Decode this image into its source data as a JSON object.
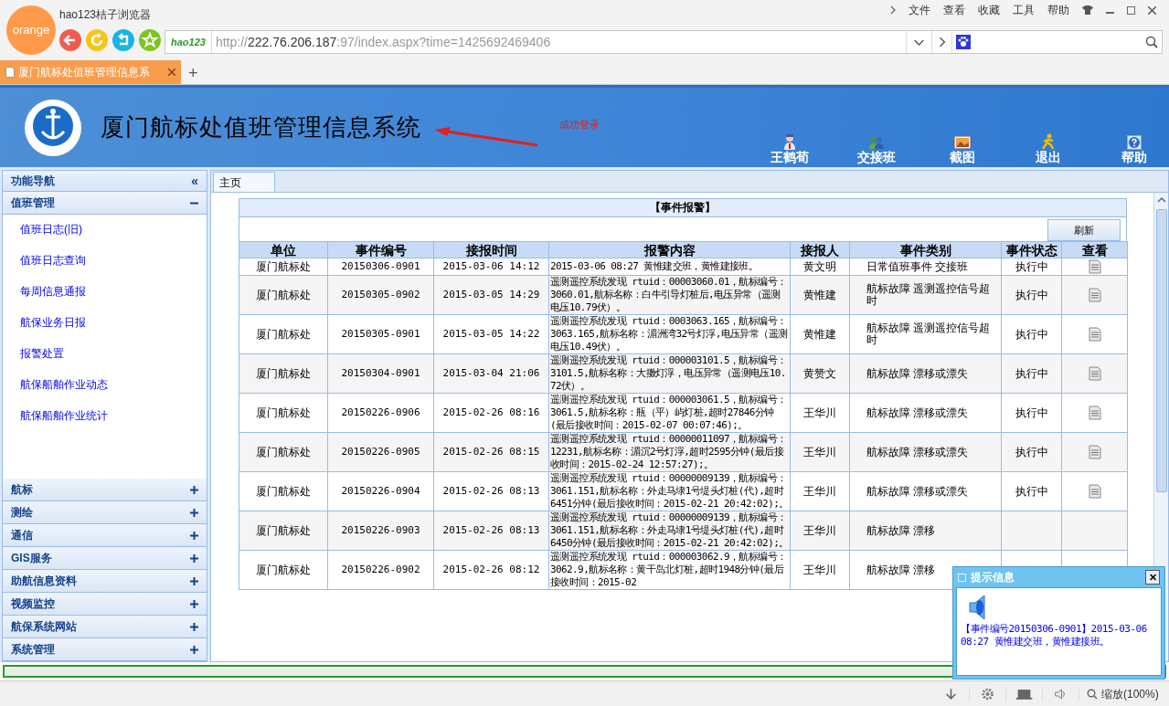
{
  "browser": {
    "logo": "orange",
    "title": "hao123桔子浏览器",
    "menu": [
      "文件",
      "查看",
      "收藏",
      "工具",
      "帮助"
    ],
    "url_badge": "hao123",
    "url": {
      "scheme": "http://",
      "host": "222.76.206.187",
      "rest": ":97/index.aspx?time=1425692469406"
    },
    "tabs": [
      {
        "label": "厦门航标处值班管理信息系",
        "selected": true
      }
    ],
    "new_tab": "+"
  },
  "header": {
    "title": "厦门航标处值班管理信息系统",
    "note": "成功登录",
    "tools": [
      {
        "kind": "user",
        "label": "王鹤荀"
      },
      {
        "kind": "handover",
        "label": "交接班"
      },
      {
        "kind": "screenshot",
        "label": "截图"
      },
      {
        "kind": "logout",
        "label": "退出"
      },
      {
        "kind": "help",
        "label": "帮助"
      }
    ]
  },
  "sidebar": {
    "title": "功能导航",
    "collapse": "«",
    "groups": [
      {
        "label": "值班管理",
        "expanded": true,
        "children": [
          {
            "label": "值班日志(旧)"
          },
          {
            "label": "值班日志查询"
          },
          {
            "label": "每周信息通报"
          },
          {
            "label": "航保业务日报"
          },
          {
            "label": "报警处置"
          },
          {
            "label": "航保船舶作业动态"
          },
          {
            "label": "航保船舶作业统计"
          }
        ]
      },
      {
        "label": "航标",
        "expanded": false
      },
      {
        "label": "测绘",
        "expanded": false
      },
      {
        "label": "通信",
        "expanded": false
      },
      {
        "label": "GIS服务",
        "expanded": false
      },
      {
        "label": "助航信息资料",
        "expanded": false
      },
      {
        "label": "视频监控",
        "expanded": false
      },
      {
        "label": "航保系统网站",
        "expanded": false
      },
      {
        "label": "系统管理",
        "expanded": false
      }
    ]
  },
  "content_tabs": [
    {
      "label": "主页",
      "selected": true
    }
  ],
  "table": {
    "title": "【事件报警】",
    "refresh": "刷新",
    "columns": [
      "单位",
      "事件编号",
      "接报时间",
      "报警内容",
      "接报人",
      "事件类别",
      "事件状态",
      "查看"
    ],
    "rows": [
      {
        "unit": "厦门航标处",
        "id": "20150306-0901",
        "time": "2015-03-06 14:12",
        "content": "2015-03-06 08:27 黄惟建交班，黄惟建接班。",
        "person": "黄文明",
        "category": "日常值班事件 交接班",
        "status": "执行中"
      },
      {
        "unit": "厦门航标处",
        "id": "20150305-0902",
        "time": "2015-03-05 14:29",
        "content": "遥测遥控系统发现 rtuid：00003060.01，航标编号：3060.01,航标名称：白牛引导灯桩后,电压异常（遥测电压10.79伏）。",
        "person": "黄惟建",
        "category": "航标故障 遥测遥控信号超时",
        "status": "执行中"
      },
      {
        "unit": "厦门航标处",
        "id": "20150305-0901",
        "time": "2015-03-05 14:22",
        "content": "遥测遥控系统发现 rtuid：0003063.165，航标编号：3063.165,航标名称：湄洲湾32号灯浮,电压异常（遥测电压10.49伏）。",
        "person": "黄惟建",
        "category": "航标故障 遥测遥控信号超时",
        "status": "执行中"
      },
      {
        "unit": "厦门航标处",
        "id": "20150304-0901",
        "time": "2015-03-04 21:06",
        "content": "遥测遥控系统发现 rtuid：000003101.5，航标编号：3101.5,航标名称：大擞灯浮，电压异常（遥测电压10.72伏）。",
        "person": "黄赞文",
        "category": "航标故障 漂移或漂失",
        "status": "执行中"
      },
      {
        "unit": "厦门航标处",
        "id": "20150226-0906",
        "time": "2015-02-26 08:16",
        "content": "遥测遥控系统发现 rtuid：000003061.5，航标编号：3061.5,航标名称：瓶（平）屿灯桩,超时27846分钟(最后接收时间：2015-02-07 00:07:46);。",
        "person": "王华川",
        "category": "航标故障 漂移或漂失",
        "status": "执行中"
      },
      {
        "unit": "厦门航标处",
        "id": "20150226-0905",
        "time": "2015-02-26 08:15",
        "content": "遥测遥控系统发现 rtuid：00000011097，航标编号：12231,航标名称：湄沉2号灯浮,超时2595分钟(最后接收时间：2015-02-24 12:57:27);。",
        "person": "王华川",
        "category": "航标故障 漂移或漂失",
        "status": "执行中"
      },
      {
        "unit": "厦门航标处",
        "id": "20150226-0904",
        "time": "2015-02-26 08:13",
        "content": "遥测遥控系统发现 rtuid：00000009139，航标编号：3061.151,航标名称：外走马埭1号堤头灯桩(代),超时6451分钟(最后接收时间：2015-02-21 20:42:02);。",
        "person": "王华川",
        "category": "航标故障 漂移或漂失",
        "status": "执行中"
      },
      {
        "unit": "厦门航标处",
        "id": "20150226-0903",
        "time": "2015-02-26 08:13",
        "content": "遥测遥控系统发现 rtuid：00000009139，航标编号：3061.151,航标名称：外走马埭1号堤头灯桩(代),超时6450分钟(最后接收时间：2015-02-21 20:42:02);。",
        "person": "王华川",
        "category": "航标故障 漂移"
      },
      {
        "unit": "厦门航标处",
        "id": "20150226-0902",
        "time": "2015-02-26 08:12",
        "content": "遥测遥控系统发现 rtuid：000003062.9，航标编号：3062.9,航标名称：黄干岛北灯桩,超时1948分钟(最后接收时间：2015-02",
        "person": "王华川",
        "category": "航标故障 漂移"
      }
    ]
  },
  "popup": {
    "title": "提示信息",
    "close": "✕",
    "message": "【事件编号20150306-0901】2015-03-06 08:27 黄惟建交班，黄惟建接班。"
  },
  "progress": {
    "level": 0
  },
  "status_bar": {
    "zoom": "缩放(100%)"
  }
}
